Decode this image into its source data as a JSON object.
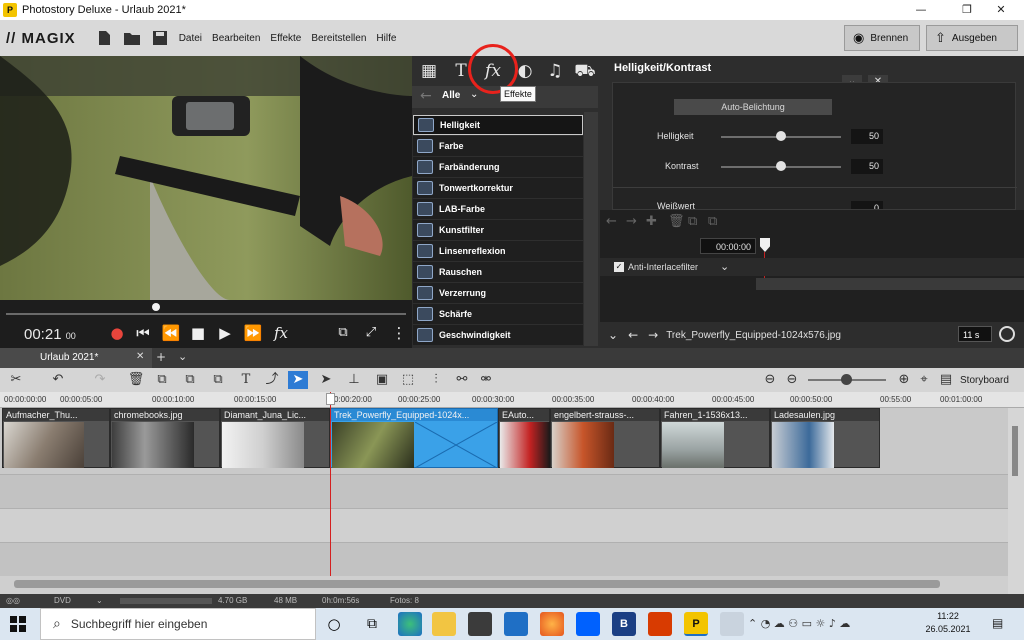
{
  "window": {
    "title": "Photostory Deluxe - Urlaub 2021*",
    "controls": [
      "—",
      "❐",
      "✕"
    ]
  },
  "menubar": {
    "logo": "MAGIX",
    "items": [
      "Datei",
      "Bearbeiten",
      "Effekte",
      "Bereitstellen",
      "Hilfe"
    ],
    "brennen": "Brennen",
    "ausgeben": "Ausgeben"
  },
  "preview": {
    "time": "00:21",
    "frames": "00",
    "fx_label": "fx"
  },
  "effects": {
    "tooltip": "Effekte",
    "filter_label": "Alle",
    "items": [
      "Helligkeit",
      "Farbe",
      "Farbänderung",
      "Tonwertkorrektur",
      "LAB-Farbe",
      "Kunstfilter",
      "Linsenreflexion",
      "Rauschen",
      "Verzerrung",
      "Schärfe",
      "Geschwindigkeit"
    ]
  },
  "properties": {
    "title": "Helligkeit/Kontrast",
    "auto_button": "Auto-Belichtung",
    "helligkeit_label": "Helligkeit",
    "helligkeit_value": "50",
    "kontrast_label": "Kontrast",
    "kontrast_value": "50",
    "partial_label": "Weißwert",
    "partial_value": "0",
    "helligkeit_level": 0.5,
    "kontrast_level": 0.5
  },
  "keyframes": {
    "time": "00:00:00",
    "anti_interlace": "Anti-Interlacefilter",
    "filename": "Trek_Powerfly_Equipped-1024x576.jpg",
    "duration": "11 s"
  },
  "timeline": {
    "tab": "Urlaub 2021*",
    "storyboard": "Storyboard",
    "ruler": [
      "00:00:00:00",
      "00:00:05:00",
      "00:00:10:00",
      "00:00:15:00",
      "0:00:20:00",
      "00:00:25:00",
      "00:00:30:00",
      "00:00:35:00",
      "00:00:40:00",
      "00:00:45:00",
      "00:00:50:00",
      "00:55:00",
      "00:01:00:00"
    ],
    "clips": [
      "Aufmacher_Thu...",
      "chromebooks.jpg",
      "Diamant_Juna_Lic...",
      "Trek_Powerfly_Equipped-1024x...",
      "EAuto...",
      "engelbert-strauss-...",
      "Fahren_1-1536x13...",
      "Ladesaulen.jpg"
    ]
  },
  "statusbar": {
    "format": "DVD",
    "size": "4.70 GB",
    "used": "48 MB",
    "duration": "0h:0m:56s",
    "fotos": "Fotos: 8"
  },
  "taskbar": {
    "search_placeholder": "Suchbegriff hier eingeben",
    "time": "11:22",
    "date": "26.05.2021"
  }
}
